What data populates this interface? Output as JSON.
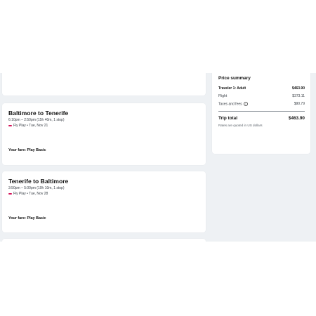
{
  "flights": [
    {
      "route": "Baltimore to Tenerife",
      "times": "6:10pm – 2:50pm (15h 40m, 1 stop)",
      "airline_date": "Fly Play • Tue, Nov 21",
      "fare": "Your fare: Play Basic"
    },
    {
      "route": "Tenerife to Baltimore",
      "times": "3:50pm – 5:00pm (10h 10m, 1 stop)",
      "airline_date": "Fly Play • Tue, Nov 28",
      "fare": "Your fare: Play Basic"
    }
  ],
  "summary": {
    "title": "Price summary",
    "traveler_label": "Traveler 1: Adult",
    "traveler_value": "$463.90",
    "flight_label": "Flight",
    "flight_value": "$373.11",
    "taxes_label": "Taxes and fees",
    "taxes_value": "$90.79",
    "total_label": "Trip total",
    "total_value": "$463.90",
    "note": "Rates are quoted in US dollars"
  },
  "colors": {
    "page_bg": "#eef1f4",
    "airline_brand": "#d4145a"
  },
  "icons": {
    "taxes_info": "info-icon"
  }
}
